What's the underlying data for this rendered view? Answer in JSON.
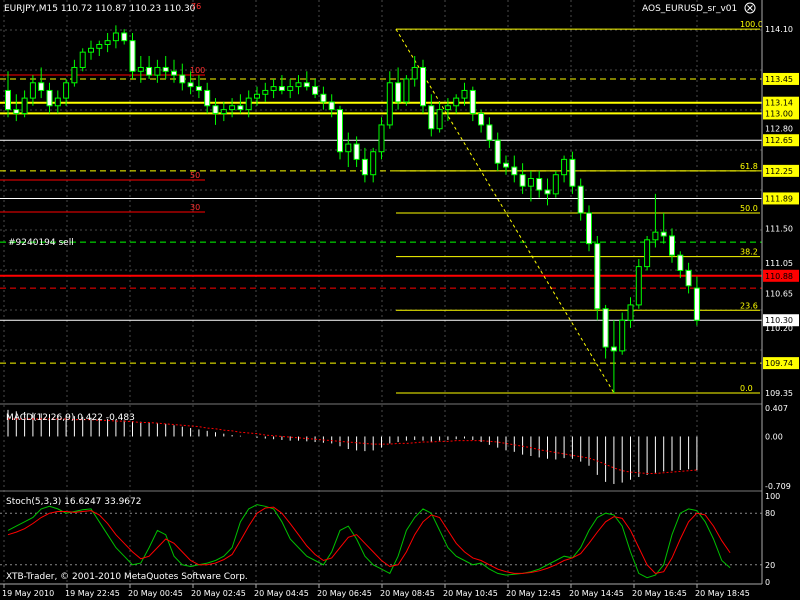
{
  "header": {
    "symbol_info": "EURJPY,M15  110.72 110.87 110.23 110.30",
    "indicator_name": "AOS_EURUSD_sr_v01",
    "close_icon": "circle-x-icon"
  },
  "order_label": "#9240194 sell",
  "price_axis": {
    "ticks": [
      "114.10",
      "113.45",
      "113.14",
      "113.00",
      "112.80",
      "112.65",
      "112.25",
      "111.89",
      "111.50",
      "111.05",
      "110.88",
      "110.65",
      "110.30",
      "110.20",
      "109.74",
      "109.35"
    ],
    "highlight": {
      "113.45": "#ffff00",
      "113.14": "#ffff00",
      "113.00": "#ffff00",
      "112.65": "#ffff00",
      "112.25": "#ffff00",
      "111.89": "#ffff00",
      "110.88": "#ff0000",
      "110.30": "#ffffff",
      "109.74": "#ffff00"
    }
  },
  "fib_labels": [
    "100.0",
    "61.8",
    "50.0",
    "38.2",
    "23.6",
    "0.0"
  ],
  "red_level_labels": [
    "100",
    "50",
    "30"
  ],
  "red_level_label_top": "76",
  "macd": {
    "label": "MACD(12,26,9) 0.422 -0.483",
    "ticks": [
      "0.407",
      "0.00",
      "-0.709"
    ]
  },
  "stoch": {
    "label": "Stoch(5,3,3) 16.6247 33.9672",
    "ticks": [
      "100",
      "80",
      "20",
      "0"
    ]
  },
  "copyright": "XTB-Trader, © 2001-2010 MetaQuotes Software Corp.",
  "time_axis": [
    "19 May 2010",
    "19 May 22:45",
    "20 May 00:45",
    "20 May 02:45",
    "20 May 04:45",
    "20 May 06:45",
    "20 May 08:45",
    "20 May 10:45",
    "20 May 12:45",
    "20 May 14:45",
    "20 May 16:45",
    "20 May 18:45"
  ],
  "colors": {
    "bull": "#000000",
    "bear": "#ffffff",
    "wick": "#00ff00",
    "grid": "#4a4a4a",
    "fib": "#ffff00",
    "red": "#ff0000"
  },
  "chart_data": {
    "type": "candlestick",
    "symbol": "EURJPY",
    "timeframe": "M15",
    "ohlc_last": {
      "open": 110.72,
      "high": 110.87,
      "low": 110.23,
      "close": 110.3
    },
    "price_range": [
      109.35,
      114.1
    ],
    "candles": [
      [
        113.3,
        113.55,
        112.95,
        113.05
      ],
      [
        113.05,
        113.25,
        112.9,
        113.0
      ],
      [
        113.0,
        113.3,
        112.95,
        113.2
      ],
      [
        113.2,
        113.5,
        113.1,
        113.4
      ],
      [
        113.4,
        113.6,
        113.2,
        113.3
      ],
      [
        113.3,
        113.4,
        113.0,
        113.1
      ],
      [
        113.1,
        113.3,
        113.0,
        113.2
      ],
      [
        113.2,
        113.45,
        113.1,
        113.4
      ],
      [
        113.4,
        113.7,
        113.35,
        113.6
      ],
      [
        113.6,
        113.85,
        113.55,
        113.8
      ],
      [
        113.8,
        113.95,
        113.7,
        113.85
      ],
      [
        113.85,
        113.95,
        113.75,
        113.9
      ],
      [
        113.9,
        114.05,
        113.8,
        113.95
      ],
      [
        113.95,
        114.15,
        113.85,
        114.05
      ],
      [
        114.05,
        114.1,
        113.9,
        113.95
      ],
      [
        113.95,
        114.05,
        113.45,
        113.55
      ],
      [
        113.55,
        113.75,
        113.4,
        113.6
      ],
      [
        113.6,
        113.75,
        113.45,
        113.5
      ],
      [
        113.5,
        113.7,
        113.4,
        113.6
      ],
      [
        113.6,
        113.75,
        113.45,
        113.55
      ],
      [
        113.55,
        113.7,
        113.4,
        113.5
      ],
      [
        113.5,
        113.65,
        113.3,
        113.4
      ],
      [
        113.4,
        113.55,
        113.25,
        113.35
      ],
      [
        113.35,
        113.5,
        113.2,
        113.3
      ],
      [
        113.3,
        113.4,
        113.0,
        113.1
      ],
      [
        113.1,
        113.2,
        112.85,
        113.0
      ],
      [
        113.0,
        113.15,
        112.9,
        113.05
      ],
      [
        113.05,
        113.2,
        112.95,
        113.1
      ],
      [
        113.1,
        113.25,
        113.0,
        113.05
      ],
      [
        113.05,
        113.3,
        112.95,
        113.2
      ],
      [
        113.2,
        113.35,
        113.1,
        113.25
      ],
      [
        113.25,
        113.4,
        113.15,
        113.3
      ],
      [
        113.3,
        113.45,
        113.2,
        113.35
      ],
      [
        113.35,
        113.5,
        113.25,
        113.3
      ],
      [
        113.3,
        113.45,
        113.2,
        113.35
      ],
      [
        113.35,
        113.5,
        113.25,
        113.4
      ],
      [
        113.4,
        113.55,
        113.3,
        113.35
      ],
      [
        113.35,
        113.45,
        113.2,
        113.25
      ],
      [
        113.25,
        113.35,
        113.05,
        113.15
      ],
      [
        113.15,
        113.25,
        112.95,
        113.05
      ],
      [
        113.05,
        113.1,
        112.4,
        112.5
      ],
      [
        112.5,
        112.75,
        112.3,
        112.6
      ],
      [
        112.6,
        112.7,
        112.3,
        112.4
      ],
      [
        112.4,
        112.55,
        112.1,
        112.2
      ],
      [
        112.2,
        112.55,
        112.1,
        112.5
      ],
      [
        112.5,
        112.95,
        112.4,
        112.85
      ],
      [
        112.85,
        113.55,
        112.8,
        113.4
      ],
      [
        113.4,
        113.6,
        113.05,
        113.15
      ],
      [
        113.15,
        113.5,
        113.1,
        113.45
      ],
      [
        113.45,
        113.75,
        113.35,
        113.6
      ],
      [
        113.6,
        113.7,
        113.0,
        113.1
      ],
      [
        113.1,
        113.25,
        112.7,
        112.8
      ],
      [
        112.8,
        113.15,
        112.75,
        113.05
      ],
      [
        113.05,
        113.2,
        112.9,
        113.1
      ],
      [
        113.1,
        113.25,
        113.0,
        113.2
      ],
      [
        113.2,
        113.4,
        113.1,
        113.3
      ],
      [
        113.3,
        113.35,
        112.9,
        113.0
      ],
      [
        113.0,
        113.05,
        112.75,
        112.85
      ],
      [
        112.85,
        112.95,
        112.55,
        112.65
      ],
      [
        112.65,
        112.75,
        112.25,
        112.35
      ],
      [
        112.35,
        112.45,
        112.2,
        112.3
      ],
      [
        112.3,
        112.45,
        112.1,
        112.2
      ],
      [
        112.2,
        112.35,
        111.95,
        112.05
      ],
      [
        112.05,
        112.25,
        111.85,
        112.15
      ],
      [
        112.15,
        112.25,
        111.9,
        112.0
      ],
      [
        112.0,
        112.15,
        111.8,
        111.95
      ],
      [
        111.95,
        112.25,
        111.9,
        112.2
      ],
      [
        112.2,
        112.45,
        112.1,
        112.4
      ],
      [
        112.4,
        112.5,
        111.95,
        112.05
      ],
      [
        112.05,
        112.15,
        111.6,
        111.7
      ],
      [
        111.7,
        111.8,
        111.2,
        111.3
      ],
      [
        111.3,
        111.4,
        110.3,
        110.45
      ],
      [
        110.45,
        110.5,
        109.8,
        109.95
      ],
      [
        109.95,
        110.3,
        109.35,
        109.9
      ],
      [
        109.9,
        110.4,
        109.85,
        110.3
      ],
      [
        110.3,
        110.6,
        110.2,
        110.5
      ],
      [
        110.5,
        111.1,
        110.45,
        111.0
      ],
      [
        111.0,
        111.4,
        110.95,
        111.35
      ],
      [
        111.35,
        111.95,
        111.25,
        111.45
      ],
      [
        111.45,
        111.7,
        111.3,
        111.4
      ],
      [
        111.4,
        111.5,
        111.05,
        111.15
      ],
      [
        111.15,
        111.2,
        110.85,
        110.95
      ],
      [
        110.95,
        111.05,
        110.65,
        110.75
      ],
      [
        110.72,
        110.87,
        110.23,
        110.3
      ]
    ],
    "fib_levels": [
      {
        "label": "100.0",
        "value": 114.1
      },
      {
        "label": "61.8",
        "value": 112.25
      },
      {
        "label": "50.0",
        "value": 111.7
      },
      {
        "label": "38.2",
        "value": 111.13
      },
      {
        "label": "23.6",
        "value": 110.43
      },
      {
        "label": "0.0",
        "value": 109.35
      }
    ],
    "horizontal_levels": [
      {
        "value": 113.45,
        "color": "#ffff00",
        "style": "dashed"
      },
      {
        "value": 113.14,
        "color": "#ffff00",
        "style": "solid"
      },
      {
        "value": 113.0,
        "color": "#ffff00",
        "style": "solid"
      },
      {
        "value": 112.65,
        "color": "#ffffff",
        "style": "solid"
      },
      {
        "value": 112.25,
        "color": "#ffff00",
        "style": "dashed"
      },
      {
        "value": 111.89,
        "color": "#ffffff",
        "style": "solid"
      },
      {
        "value": 111.32,
        "color": "#00ff00",
        "style": "dashed"
      },
      {
        "value": 110.88,
        "color": "#ff0000",
        "style": "solid"
      },
      {
        "value": 110.72,
        "color": "#ff0000",
        "style": "dashed"
      },
      {
        "value": 110.3,
        "color": "#ffffff",
        "style": "solid"
      },
      {
        "value": 109.74,
        "color": "#ffff00",
        "style": "dashed"
      }
    ],
    "macd": {
      "params": "12,26,9",
      "range": [
        -0.709,
        0.407
      ],
      "histogram": [
        0.38,
        0.36,
        0.35,
        0.34,
        0.33,
        0.32,
        0.31,
        0.3,
        0.29,
        0.28,
        0.27,
        0.26,
        0.25,
        0.24,
        0.23,
        0.22,
        0.21,
        0.2,
        0.19,
        0.18,
        0.16,
        0.14,
        0.12,
        0.1,
        0.08,
        0.06,
        0.04,
        0.02,
        0.01,
        0.0,
        -0.02,
        -0.03,
        -0.04,
        -0.05,
        -0.06,
        -0.06,
        -0.07,
        -0.08,
        -0.09,
        -0.1,
        -0.14,
        -0.18,
        -0.2,
        -0.21,
        -0.2,
        -0.16,
        -0.1,
        -0.08,
        -0.06,
        -0.05,
        -0.06,
        -0.08,
        -0.06,
        -0.05,
        -0.04,
        -0.03,
        -0.05,
        -0.08,
        -0.12,
        -0.16,
        -0.2,
        -0.22,
        -0.26,
        -0.28,
        -0.3,
        -0.32,
        -0.33,
        -0.31,
        -0.32,
        -0.36,
        -0.42,
        -0.55,
        -0.65,
        -0.68,
        -0.66,
        -0.62,
        -0.58,
        -0.55,
        -0.52,
        -0.5,
        -0.49,
        -0.48,
        -0.47,
        -0.483
      ],
      "signal": [
        0.25,
        0.25,
        0.25,
        0.25,
        0.25,
        0.25,
        0.25,
        0.25,
        0.24,
        0.24,
        0.24,
        0.23,
        0.23,
        0.22,
        0.22,
        0.21,
        0.2,
        0.2,
        0.19,
        0.18,
        0.17,
        0.16,
        0.15,
        0.14,
        0.12,
        0.11,
        0.09,
        0.08,
        0.06,
        0.05,
        0.04,
        0.02,
        0.01,
        0.0,
        -0.01,
        -0.02,
        -0.03,
        -0.04,
        -0.05,
        -0.06,
        -0.07,
        -0.08,
        -0.09,
        -0.1,
        -0.11,
        -0.11,
        -0.11,
        -0.1,
        -0.1,
        -0.09,
        -0.08,
        -0.08,
        -0.07,
        -0.07,
        -0.06,
        -0.06,
        -0.06,
        -0.06,
        -0.07,
        -0.08,
        -0.1,
        -0.12,
        -0.14,
        -0.16,
        -0.19,
        -0.21,
        -0.23,
        -0.25,
        -0.27,
        -0.29,
        -0.31,
        -0.35,
        -0.4,
        -0.45,
        -0.49,
        -0.51,
        -0.52,
        -0.53,
        -0.53,
        -0.52,
        -0.51,
        -0.5,
        -0.49,
        -0.48
      ]
    },
    "stochastic": {
      "params": "5,3,3",
      "range": [
        0,
        100
      ],
      "levels": [
        80,
        20
      ],
      "k": [
        60,
        65,
        70,
        75,
        85,
        88,
        85,
        80,
        82,
        84,
        85,
        70,
        55,
        40,
        30,
        20,
        22,
        40,
        60,
        55,
        30,
        20,
        18,
        20,
        22,
        25,
        30,
        40,
        70,
        85,
        90,
        88,
        85,
        70,
        50,
        40,
        30,
        25,
        20,
        35,
        60,
        65,
        50,
        30,
        20,
        15,
        10,
        30,
        60,
        75,
        85,
        80,
        60,
        40,
        30,
        25,
        20,
        22,
        15,
        10,
        8,
        9,
        10,
        12,
        15,
        20,
        25,
        30,
        28,
        40,
        60,
        75,
        80,
        78,
        65,
        35,
        10,
        5,
        8,
        20,
        55,
        80,
        85,
        83,
        70,
        50,
        25,
        16.6
      ],
      "d": [
        55,
        58,
        62,
        68,
        75,
        80,
        82,
        82,
        81,
        82,
        83,
        78,
        68,
        55,
        45,
        35,
        27,
        30,
        40,
        50,
        45,
        35,
        25,
        20,
        20,
        22,
        26,
        32,
        48,
        65,
        80,
        86,
        87,
        80,
        68,
        55,
        42,
        32,
        25,
        28,
        40,
        52,
        55,
        45,
        35,
        25,
        18,
        20,
        35,
        55,
        70,
        78,
        75,
        60,
        45,
        35,
        28,
        25,
        20,
        15,
        12,
        10,
        10,
        11,
        13,
        16,
        20,
        25,
        28,
        33,
        45,
        58,
        70,
        76,
        74,
        60,
        40,
        20,
        10,
        12,
        28,
        50,
        70,
        80,
        78,
        65,
        48,
        34
      ]
    }
  }
}
